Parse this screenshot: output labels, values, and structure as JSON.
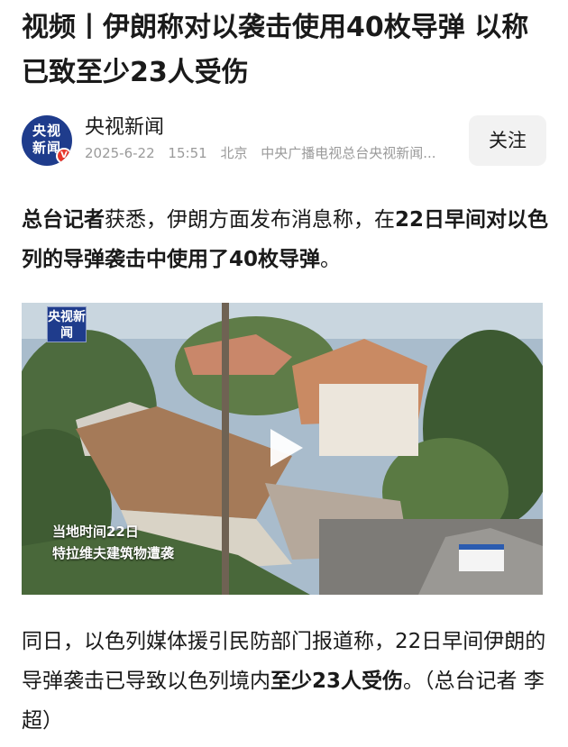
{
  "article": {
    "title": "视频丨伊朗称对以袭击使用40枚导弹 以称已致至少23人受伤"
  },
  "author": {
    "avatar_text": "央视新闻",
    "name": "央视新闻",
    "date": "2025-6-22",
    "time": "15:51",
    "location": "北京",
    "source": "中央广播电视总台央视新闻..."
  },
  "follow_button": {
    "label": "关注"
  },
  "paragraph1": {
    "bold_lead": "总台记者",
    "text1": "获悉，伊朗方面发布消息称，在",
    "bold_mid": "22日早间对以色列的导弹袭击中使用了40枚导弹",
    "text2": "。"
  },
  "video": {
    "badge": "央视新闻",
    "caption_line1": "当地时间22日",
    "caption_line2": "特拉维夫建筑物遭袭"
  },
  "paragraph2": {
    "text1": "同日，以色列媒体援引民防部门报道称，22日早间伊朗的导弹袭击已导致以色列境内",
    "bold": "至少23人受伤",
    "text2": "。（总台记者 李超）"
  },
  "colors": {
    "brand_blue": "#1f3c8c",
    "verified_red": "#e8362b",
    "meta_gray": "#9a9a9a",
    "button_bg": "#f2f2f2"
  },
  "icons": {
    "verified": "verified-v-icon",
    "play": "play-icon"
  }
}
